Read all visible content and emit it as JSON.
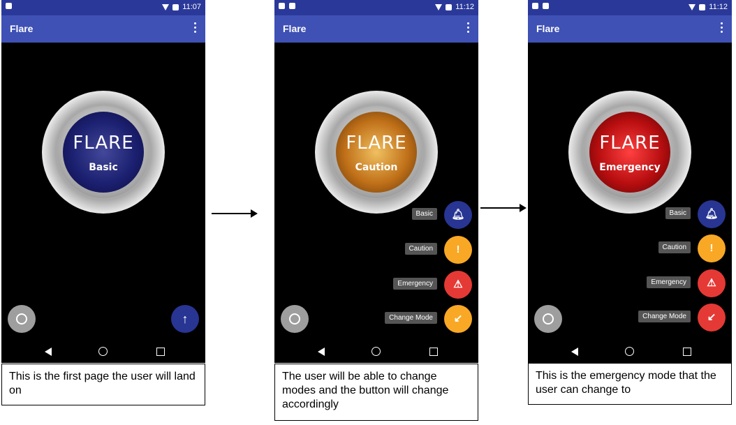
{
  "app_title": "Flare",
  "statusbar": {
    "times": [
      "11:07",
      "11:12",
      "11:12"
    ]
  },
  "button": {
    "brand": "FLARE"
  },
  "screens": [
    {
      "mode": "Basic",
      "caption": "This is the first page the user will land on"
    },
    {
      "mode": "Caution",
      "caption": "The user will be able to change modes and the button will change accordingly"
    },
    {
      "mode": "Emergency",
      "caption": "This is the emergency mode that the user can change to"
    }
  ],
  "mode_menu": {
    "items": [
      "Basic",
      "Caution",
      "Emergency",
      "Change Mode"
    ]
  },
  "icons": {
    "basic": "bell-icon",
    "caution": "exclamation-icon",
    "emergency": "warning-icon",
    "change_mode": "arrow-down-left-icon",
    "history": "history-icon",
    "up": "arrow-up-icon"
  },
  "colors": {
    "appbar": "#3f51b5",
    "statusbar": "#2a3999",
    "basic": "#283593",
    "caution": "#f9a825",
    "emergency": "#e53935",
    "history": "#9e9e9e"
  }
}
